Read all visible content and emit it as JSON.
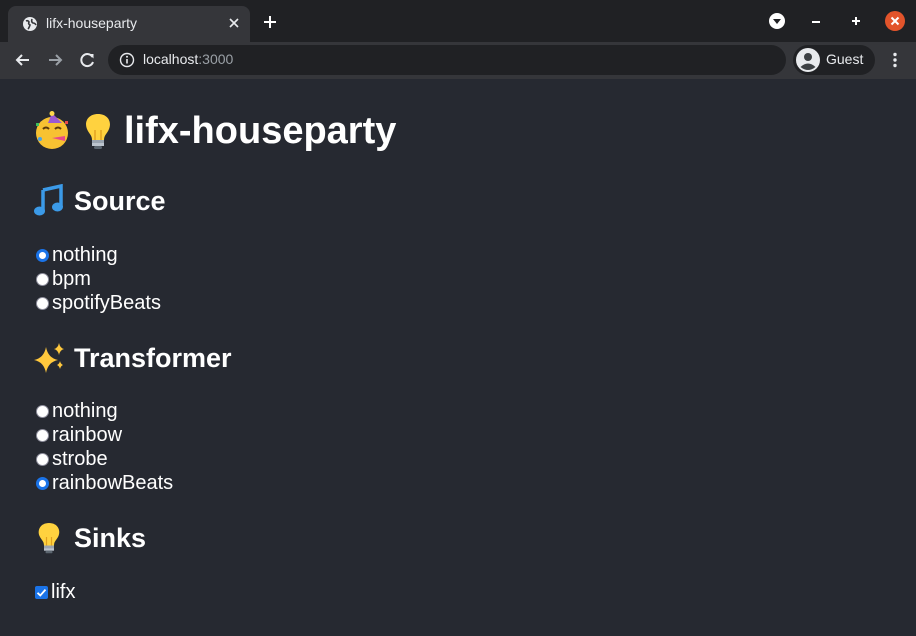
{
  "browser": {
    "tab_title": "lifx-houseparty",
    "url_host": "localhost",
    "url_port": ":3000",
    "profile_label": "Guest",
    "colors": {
      "frame": "#202124",
      "toolbar": "#35363a",
      "close_button": "#e2542b"
    }
  },
  "page": {
    "background": "#262931",
    "title": "lifx-houseparty",
    "title_icons": [
      "party-face-icon",
      "light-bulb-icon"
    ],
    "source": {
      "heading": "Source",
      "icon": "musical-note-icon",
      "options": [
        {
          "label": "nothing",
          "checked": true
        },
        {
          "label": "bpm",
          "checked": false
        },
        {
          "label": "spotifyBeats",
          "checked": false
        }
      ]
    },
    "transformer": {
      "heading": "Transformer",
      "icon": "sparkles-icon",
      "options": [
        {
          "label": "nothing",
          "checked": false
        },
        {
          "label": "rainbow",
          "checked": false
        },
        {
          "label": "strobe",
          "checked": false
        },
        {
          "label": "rainbowBeats",
          "checked": true
        }
      ]
    },
    "sinks": {
      "heading": "Sinks",
      "icon": "light-bulb-icon",
      "options": [
        {
          "label": "lifx",
          "checked": true
        }
      ]
    }
  }
}
